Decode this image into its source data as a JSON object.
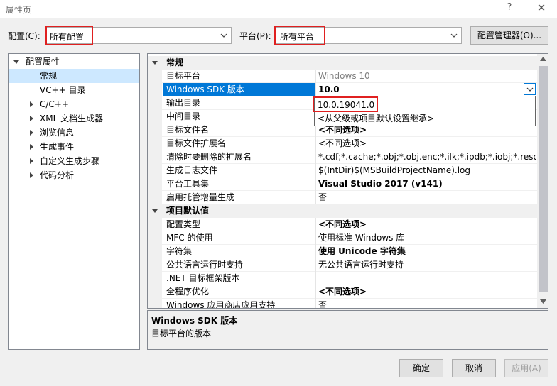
{
  "window": {
    "title": "属性页",
    "help_glyph": "?",
    "close_glyph": "✕"
  },
  "toolbar": {
    "config_label": "配置(C):",
    "config_value": "所有配置",
    "platform_label": "平台(P):",
    "platform_value": "所有平台",
    "config_manager_label": "配置管理器(O)..."
  },
  "tree": {
    "items": [
      {
        "label": "配置属性",
        "expander": "expanded"
      },
      {
        "label": "常规",
        "selected": true
      },
      {
        "label": "VC++ 目录"
      },
      {
        "label": "C/C++",
        "expander": "collapsed"
      },
      {
        "label": "XML 文档生成器",
        "expander": "collapsed"
      },
      {
        "label": "浏览信息",
        "expander": "collapsed"
      },
      {
        "label": "生成事件",
        "expander": "collapsed"
      },
      {
        "label": "自定义生成步骤",
        "expander": "collapsed"
      },
      {
        "label": "代码分析",
        "expander": "collapsed"
      }
    ]
  },
  "grid": {
    "category_general": "常规",
    "category_project_defaults": "项目默认值",
    "general_rows": [
      {
        "name": "目标平台",
        "value": "Windows 10",
        "grayed": true
      },
      {
        "name": "Windows SDK 版本",
        "value": "10.0",
        "bold": true,
        "selected": true
      },
      {
        "name": "输出目录",
        "value": ""
      },
      {
        "name": "中间目录",
        "value": ""
      },
      {
        "name": "目标文件名",
        "value": "<不同选项>",
        "bold": true
      },
      {
        "name": "目标文件扩展名",
        "value": "<不同选项>"
      },
      {
        "name": "清除时要删除的扩展名",
        "value": "*.cdf;*.cache;*.obj;*.obj.enc;*.ilk;*.ipdb;*.iobj;*.resources;*.tlb"
      },
      {
        "name": "生成日志文件",
        "value": "$(IntDir)$(MSBuildProjectName).log"
      },
      {
        "name": "平台工具集",
        "value": "Visual Studio 2017 (v141)",
        "bold": true
      },
      {
        "name": "启用托管增量生成",
        "value": "否"
      }
    ],
    "default_rows": [
      {
        "name": "配置类型",
        "value": "<不同选项>",
        "bold": true
      },
      {
        "name": "MFC 的使用",
        "value": "使用标准 Windows 库"
      },
      {
        "name": "字符集",
        "value": "使用 Unicode 字符集",
        "bold": true
      },
      {
        "name": "公共语言运行时支持",
        "value": "无公共语言运行时支持"
      },
      {
        "name": ".NET 目标框架版本",
        "value": ""
      },
      {
        "name": "全程序优化",
        "value": "<不同选项>",
        "bold": true
      },
      {
        "name": "Windows 应用商店应用支持",
        "value": "否"
      }
    ]
  },
  "dropdown": {
    "options": [
      "10.0.19041.0",
      "<从父级或项目默认设置继承>"
    ]
  },
  "description": {
    "title": "Windows SDK 版本",
    "text": "目标平台的版本"
  },
  "buttons": {
    "ok": "确定",
    "cancel": "取消",
    "apply": "应用(A)"
  },
  "colors": {
    "highlight": "#e02020",
    "selection": "#0078d7",
    "tree_selection": "#cde8ff"
  }
}
